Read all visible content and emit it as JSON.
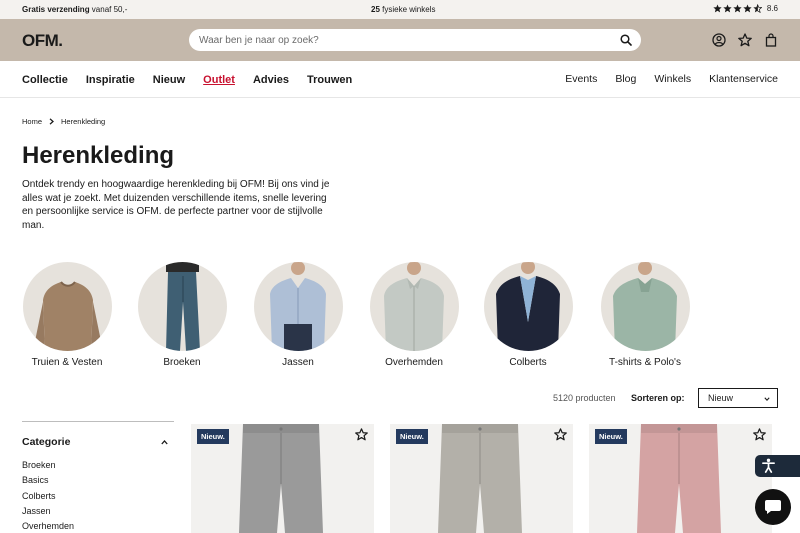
{
  "topbar": {
    "shipping_bold": "Gratis verzending",
    "shipping_rest": " vanaf 50,-",
    "stores_count": "25",
    "stores_label": " fysieke winkels",
    "rating": "8.6"
  },
  "header": {
    "logo": "OFM.",
    "search_placeholder": "Waar ben je naar op zoek?"
  },
  "nav": {
    "main": [
      "Collectie",
      "Inspiratie",
      "Nieuw",
      "Outlet",
      "Advies",
      "Trouwen"
    ],
    "secondary": [
      "Events",
      "Blog",
      "Winkels",
      "Klantenservice"
    ]
  },
  "breadcrumb": [
    "Home",
    "Herenkleding"
  ],
  "page": {
    "title": "Herenkleding",
    "intro": "Ontdek trendy en hoogwaardige herenkleding bij OFM! Bij ons vind je alles wat je zoekt. Met duizenden verschillende items, snelle levering en persoonlijke service is OFM. de perfecte partner voor de stijlvolle man."
  },
  "categories": [
    "Truien & Vesten",
    "Broeken",
    "Jassen",
    "Overhemden",
    "Colberts",
    "T-shirts & Polo's"
  ],
  "listing": {
    "count": "5120 producten",
    "sort_label": "Sorteren op:",
    "sort_value": "Nieuw"
  },
  "filter": {
    "title": "Categorie",
    "items": [
      "Broeken",
      "Basics",
      "Colberts",
      "Jassen",
      "Overhemden"
    ]
  },
  "products": [
    {
      "badge": "Nieuw.",
      "color": "#9a9a9a"
    },
    {
      "badge": "Nieuw.",
      "color": "#b3b0a9"
    },
    {
      "badge": "Nieuw.",
      "color": "#d4a3a3"
    }
  ],
  "colors": {
    "header_bg": "#c4b8ab",
    "topbar_bg": "#f4f2ef",
    "outlet_red": "#c8102e",
    "badge_navy": "#243a5e"
  }
}
